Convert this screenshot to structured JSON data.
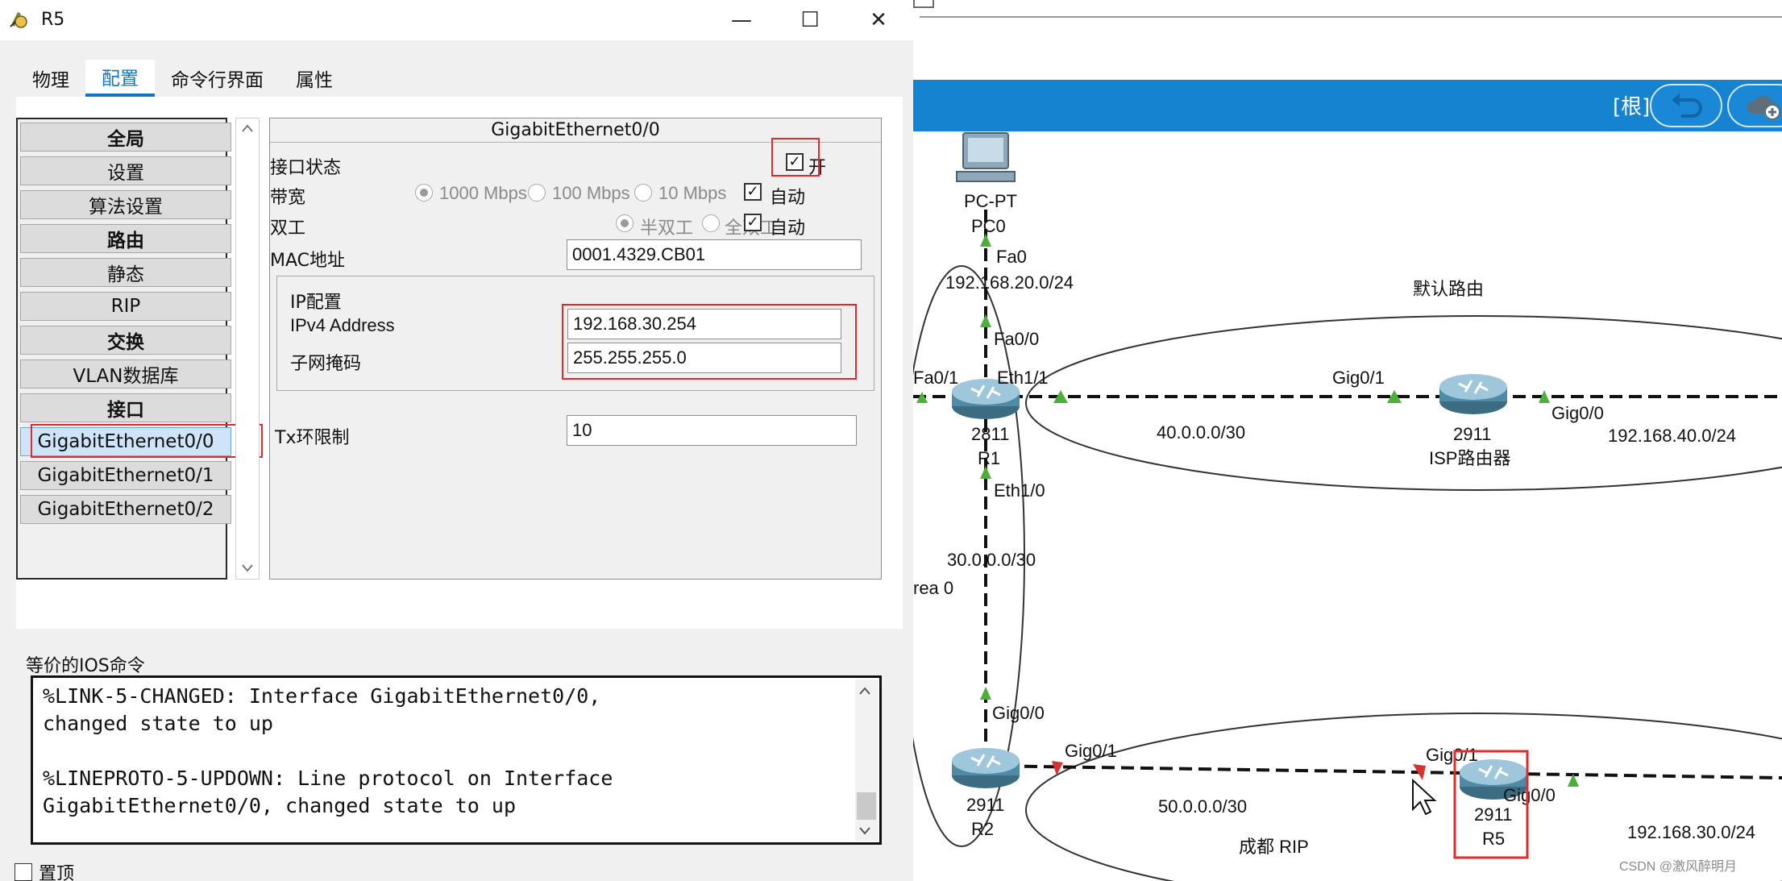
{
  "window": {
    "title": "R5",
    "minimize": "—",
    "maximize": "☐",
    "close": "✕"
  },
  "tabs": [
    {
      "label": "物理"
    },
    {
      "label": "配置",
      "active": true
    },
    {
      "label": "命令行界面"
    },
    {
      "label": "属性"
    }
  ],
  "tree": {
    "items": [
      {
        "label": "全局",
        "bold": true
      },
      {
        "label": "设置"
      },
      {
        "label": "算法设置"
      },
      {
        "label": "路由",
        "bold": true
      },
      {
        "label": "静态"
      },
      {
        "label": "RIP"
      },
      {
        "label": "交换",
        "bold": true
      },
      {
        "label": "VLAN数据库"
      },
      {
        "label": "接口",
        "bold": true
      },
      {
        "label": "GigabitEthernet0/0",
        "selected": true
      },
      {
        "label": "GigabitEthernet0/1"
      },
      {
        "label": "GigabitEthernet0/2"
      }
    ]
  },
  "iface": {
    "title": "GigabitEthernet0/0",
    "port_status_label": "接口状态",
    "port_on_label": "开",
    "bandwidth_label": "带宽",
    "bw_1000": "1000 Mbps",
    "bw_100": "100 Mbps",
    "bw_10": "10 Mbps",
    "auto_label": "自动",
    "duplex_label": "双工",
    "duplex_half": "半双工",
    "duplex_full": "全双工",
    "mac_label": "MAC地址",
    "mac_value": "0001.4329.CB01",
    "ip_group_label": "IP配置",
    "ipv4_label": "IPv4 Address",
    "ipv4_value": "192.168.30.254",
    "mask_label": "子网掩码",
    "mask_value": "255.255.255.0",
    "tx_label": "Tx环限制",
    "tx_value": "10"
  },
  "ios": {
    "title": "等价的IOS命令",
    "text": "%LINK-5-CHANGED: Interface GigabitEthernet0/0,\nchanged state to up\n\n%LINEPROTO-5-UPDOWN: Line protocol on Interface\nGigabitEthernet0/0, changed state to up"
  },
  "footer": {
    "topmost_label": "置顶"
  },
  "topology": {
    "root_label": "[根]",
    "labels": {
      "pc_model": "PC-PT",
      "pc_name": "PC0",
      "pc_port": "Fa0",
      "net_pc": "192.168.20.0/24",
      "default_route": "默认路由",
      "r1_fa00": "Fa0/0",
      "r1_fa01": "Fa0/1",
      "r1_eth11": "Eth1/1",
      "isp_gig01": "Gig0/1",
      "isp_model": "2911",
      "isp_name": "ISP路由器",
      "isp_gig00": "Gig0/0",
      "net_isp": "192.168.40.0/24",
      "net_r1_isp": "40.0.0.0/30",
      "r1_model": "2811",
      "r1_name": "R1",
      "r1_eth10": "Eth1/0",
      "net_r1_r2": "30.0.0.0/30",
      "area": "rea 0",
      "r2_gig00": "Gig0/0",
      "r2_gig01": "Gig0/1",
      "r2_model": "2911",
      "r2_name": "R2",
      "net_r2_r5": "50.0.0.0/30",
      "chengdu_rip": "成都   RIP",
      "r5_gig01": "Gig0/1",
      "r5_gig00": "Gig0/0",
      "r5_model": "2911",
      "r5_name": "R5",
      "net_r5": "192.168.30.0/24",
      "watermark": "CSDN @激风醉明月"
    },
    "colors": {
      "bar": "#1683d1",
      "link_up": "#4caf3a",
      "link_down": "#d93030",
      "highlight": "#e22a2a"
    }
  }
}
